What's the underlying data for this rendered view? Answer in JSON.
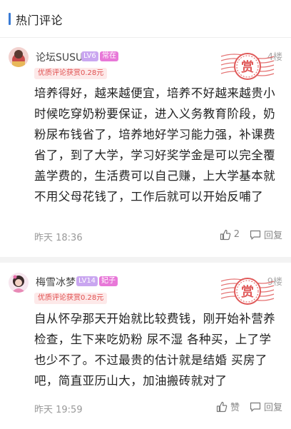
{
  "section_title": "热门评论",
  "comments": [
    {
      "username": "论坛SUSU",
      "level": "LV6",
      "tag": "常在",
      "floor": "4楼",
      "reward": "优质评论获赏0.28元",
      "stamp_text": "赏",
      "body": "培养得好，越来越便宜，培养不好越来越贵小时候吃穿奶粉要保证，进入义务教育阶段，奶粉尿布钱省了，培养地好学习能力强，补课费省了，到了大学，学习好奖学金是可以完全覆盖学费的，生活费可以自己赚，上大学基本就不用父母花钱了，工作后就可以开始反哺了",
      "time": "昨天 18:36",
      "like_count": "2",
      "reply_label": "回复"
    },
    {
      "username": "梅雪冰梦",
      "level": "LV14",
      "tag": "妃子",
      "floor": "9楼",
      "reward": "优质评论获赏0.28元",
      "stamp_text": "赏",
      "body": "自从怀孕那天开始就比较费钱，刚开始补营养  检查，生下来吃奶粉  尿不湿  各种买，上了学也少不了。不过最贵的估计就是结婚  买房了吧，简直亚历山大，加油搬砖就对了",
      "time": "昨天 19:59",
      "like_label": "赞",
      "reply_label": "回复"
    }
  ],
  "colors": {
    "accent": "#3a7bd5",
    "reward_text": "#e05050",
    "reward_bg": "#fde9e9",
    "level_badge": "#c9a6f0",
    "tag_badge": "#e878d8",
    "stamp": "#e05a5a"
  },
  "icons": [
    "thumbs-up-icon",
    "comment-icon",
    "reward-stamp-icon"
  ]
}
